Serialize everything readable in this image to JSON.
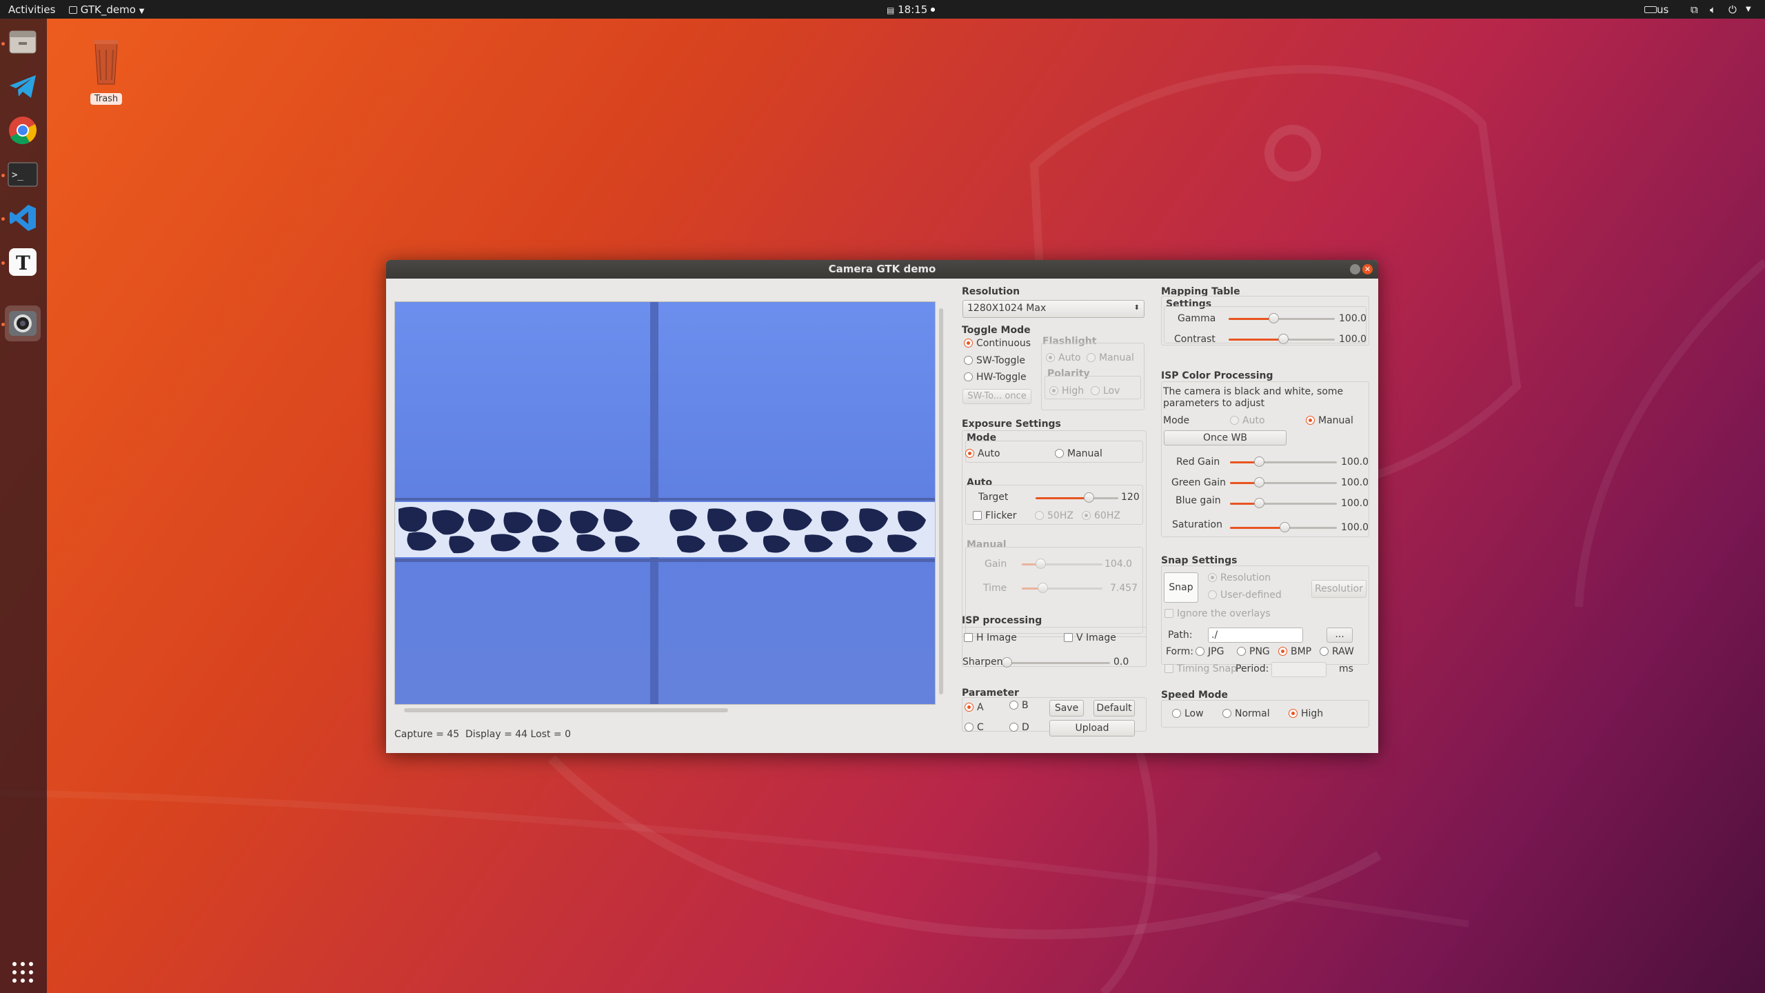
{
  "topbar": {
    "activities": "Activities",
    "app_menu": "GTK_demo",
    "clock": "18:15",
    "keyboard": "us"
  },
  "desktop": {
    "trash_label": "Trash"
  },
  "dock": {
    "items": [
      "files-icon",
      "telegram-icon",
      "chrome-icon",
      "terminal-icon",
      "vscode-icon",
      "text-editor-icon",
      "camera-app-icon"
    ],
    "apps_grid": "show-applications-icon"
  },
  "window": {
    "title": "Camera GTK demo",
    "status": {
      "capture_label": "Capture = 45",
      "display_label": "Display = 44",
      "lost_label": "Lost = 0"
    },
    "resolution": {
      "heading": "Resolution",
      "selected": "1280X1024 Max"
    },
    "toggle_mode": {
      "heading": "Toggle Mode",
      "continuous": "Continuous",
      "sw_toggle": "SW-Toggle",
      "hw_toggle": "HW-Toggle",
      "sw_once": "SW-To... once",
      "flashlight": {
        "heading": "Flashlight",
        "auto": "Auto",
        "manual": "Manual",
        "polarity": "Polarity",
        "high": "High",
        "low": "Lov"
      }
    },
    "exposure": {
      "heading": "Exposure Settings",
      "mode_heading": "Mode",
      "auto": "Auto",
      "manual": "Manual",
      "auto_heading": "Auto",
      "target_label": "Target",
      "target_value": "120",
      "target_level": 0.64,
      "flicker": "Flicker",
      "hz50": "50HZ",
      "hz60": "60HZ",
      "manual_heading": "Manual",
      "gain_label": "Gain",
      "gain_value": "104.0",
      "gain_level": 0.23,
      "time_label": "Time",
      "time_value": "7.457",
      "time_level": 0.26
    },
    "isp": {
      "heading": "ISP processing",
      "h_image": "H Image",
      "v_image": "V Image",
      "sharpen_label": "Sharpen",
      "sharpen_value": "0.0",
      "sharpen_level": 0.0
    },
    "parameter": {
      "heading": "Parameter",
      "a": "A",
      "b": "B",
      "c": "C",
      "d": "D",
      "save": "Save",
      "default": "Default",
      "upload": "Upload"
    },
    "mapping": {
      "heading": "Mapping Table",
      "settings": "Settings",
      "gamma_label": "Gamma",
      "gamma_value": "100.0",
      "gamma_level": 0.42,
      "contrast_label": "Contrast",
      "contrast_value": "100.0",
      "contrast_level": 0.51
    },
    "isp_color": {
      "heading": "ISP Color Processing",
      "note": "The camera is black and white, some parameters to adjust",
      "mode_label": "Mode",
      "auto": "Auto",
      "manual": "Manual",
      "once_wb": "Once WB",
      "red_label": "Red Gain",
      "red_value": "100.0",
      "red_level": 0.27,
      "green_label": "Green Gain",
      "green_value": "100.0",
      "green_level": 0.27,
      "blue_label": "Blue gain",
      "blue_value": "100.0",
      "blue_level": 0.27,
      "sat_label": "Saturation",
      "sat_value": "100.0",
      "sat_level": 0.51
    },
    "snap": {
      "heading": "Snap Settings",
      "snap_button": "Snap",
      "resolution": "Resolution",
      "user_defined": "User-defined",
      "resolution_button": "Resolutior",
      "ignore": "Ignore the overlays",
      "path_label": "Path:",
      "path_value": "./",
      "browse": "...",
      "form_label": "Form:",
      "jpg": "JPG",
      "png": "PNG",
      "bmp": "BMP",
      "raw": "RAW",
      "timing": "Timing Snap",
      "period_label": "Period:",
      "period_value": "",
      "ms": "ms"
    },
    "speed": {
      "heading": "Speed Mode",
      "low": "Low",
      "normal": "Normal",
      "high": "High"
    }
  },
  "colors": {
    "accent": "#e95420",
    "topbar": "#1d1d1d",
    "window_bg": "#e9e8e6"
  }
}
